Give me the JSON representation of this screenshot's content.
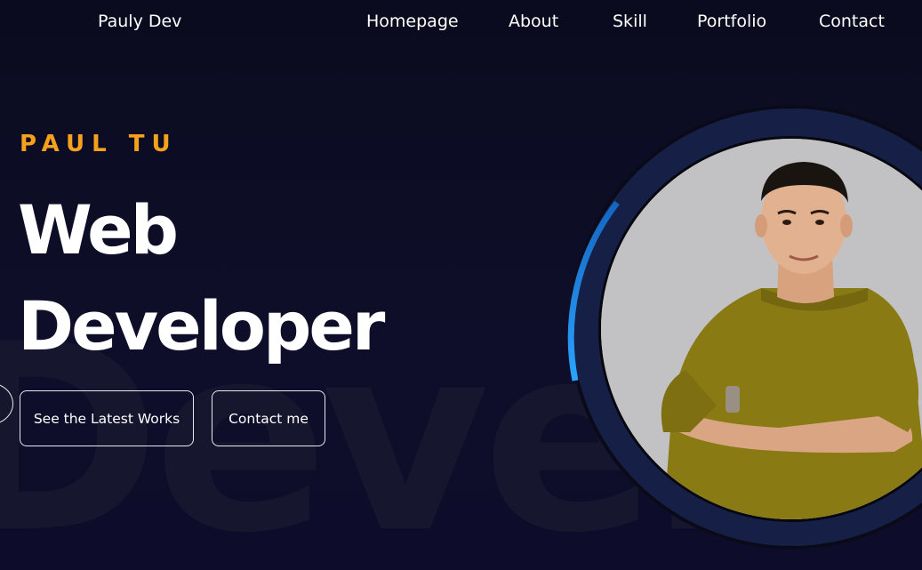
{
  "nav": {
    "brand": "Pauly Dev",
    "links": [
      "Homepage",
      "About",
      "Skill",
      "Portfolio",
      "Contact"
    ]
  },
  "hero": {
    "eyebrow": "PAUL TU",
    "headline_line1": "Web",
    "headline_line2": "Developer",
    "background_word": "Developer",
    "buttons": {
      "works": "See the Latest Works",
      "contact": "Contact me"
    }
  },
  "colors": {
    "background": "#0b0b1e",
    "accent_orange": "#f6a11d",
    "ring_blue": "#1e88e5",
    "ring_dark": "#162047",
    "shirt": "#8a7a14"
  },
  "icons": [
    "avatar-photo"
  ]
}
